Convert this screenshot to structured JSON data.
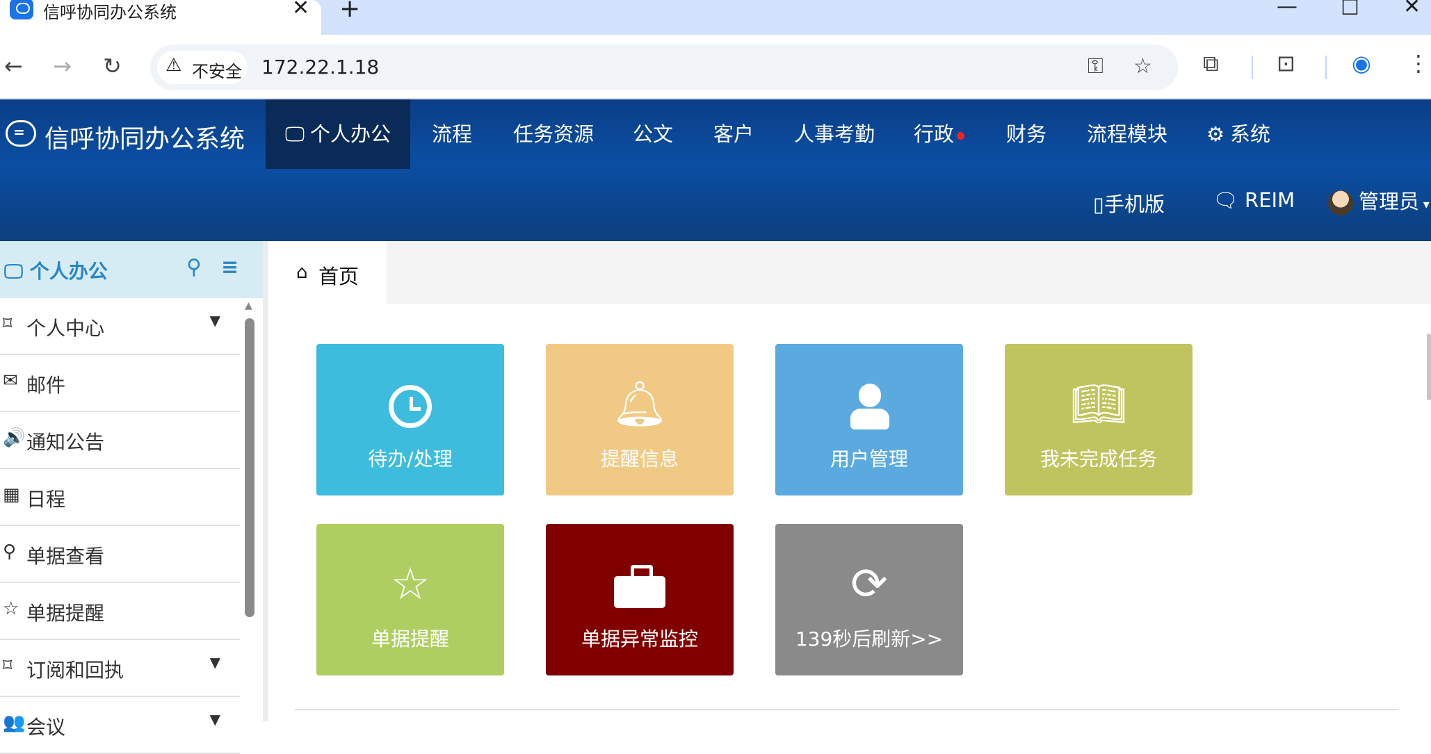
{
  "browser": {
    "tab_title": "信呼协同办公系统",
    "tab_close": "✕",
    "new_tab": "+",
    "minimize": "—",
    "maximize": "☐",
    "close": "✕",
    "back": "←",
    "forward": "→",
    "reload": "↻",
    "security_label": "不安全",
    "url": "172.22.1.18",
    "icons": [
      "key-icon",
      "star-icon",
      "extensions-icon",
      "tab-search-icon",
      "profile-icon",
      "more-menu-icon"
    ]
  },
  "app": {
    "logo_text": "信呼协同办公系统",
    "menu": [
      {
        "label": "个人办公",
        "icon": "monitor-icon",
        "active": true
      },
      {
        "label": "流程"
      },
      {
        "label": "任务资源"
      },
      {
        "label": "公文"
      },
      {
        "label": "客户"
      },
      {
        "label": "人事考勤"
      },
      {
        "label": "行政",
        "badge_color": "#ff1f1f"
      },
      {
        "label": "财务"
      },
      {
        "label": "流程模块"
      },
      {
        "label": "系统",
        "icon": "gear-icon"
      }
    ],
    "mobile_label": "手机版",
    "reim_label": "REIM",
    "user_label": "管理员"
  },
  "sidebar": {
    "title": "个人办公",
    "items": [
      {
        "label": "个人中心",
        "icon": "bookmark-icon",
        "expandable": true
      },
      {
        "label": "邮件",
        "icon": "envelope-icon"
      },
      {
        "label": "通知公告",
        "icon": "volume-icon"
      },
      {
        "label": "日程",
        "icon": "calendar-icon"
      },
      {
        "label": "单据查看",
        "icon": "search-icon"
      },
      {
        "label": "单据提醒",
        "icon": "star-icon"
      },
      {
        "label": "订阅和回执",
        "icon": "bookmark-icon",
        "expandable": true
      },
      {
        "label": "会议",
        "icon": "users-icon",
        "expandable": true
      }
    ]
  },
  "main": {
    "tab_label": "首页",
    "tiles": [
      {
        "label": "待办/处理",
        "icon": "clock-icon",
        "color": "#3dbcdd"
      },
      {
        "label": "提醒信息",
        "icon": "bell-icon",
        "color": "#f0ca84"
      },
      {
        "label": "用户管理",
        "icon": "user-icon",
        "color": "#5aaae0"
      },
      {
        "label": "我未完成任务",
        "icon": "book-icon",
        "color": "#bfc45e"
      },
      {
        "label": "单据提醒",
        "icon": "star-icon",
        "color": "#aece62"
      },
      {
        "label": "单据异常监控",
        "icon": "briefcase-icon",
        "color": "#800000"
      },
      {
        "label": "139秒后刷新>>",
        "icon": "refresh-icon",
        "color": "#8a8a8a"
      }
    ]
  }
}
